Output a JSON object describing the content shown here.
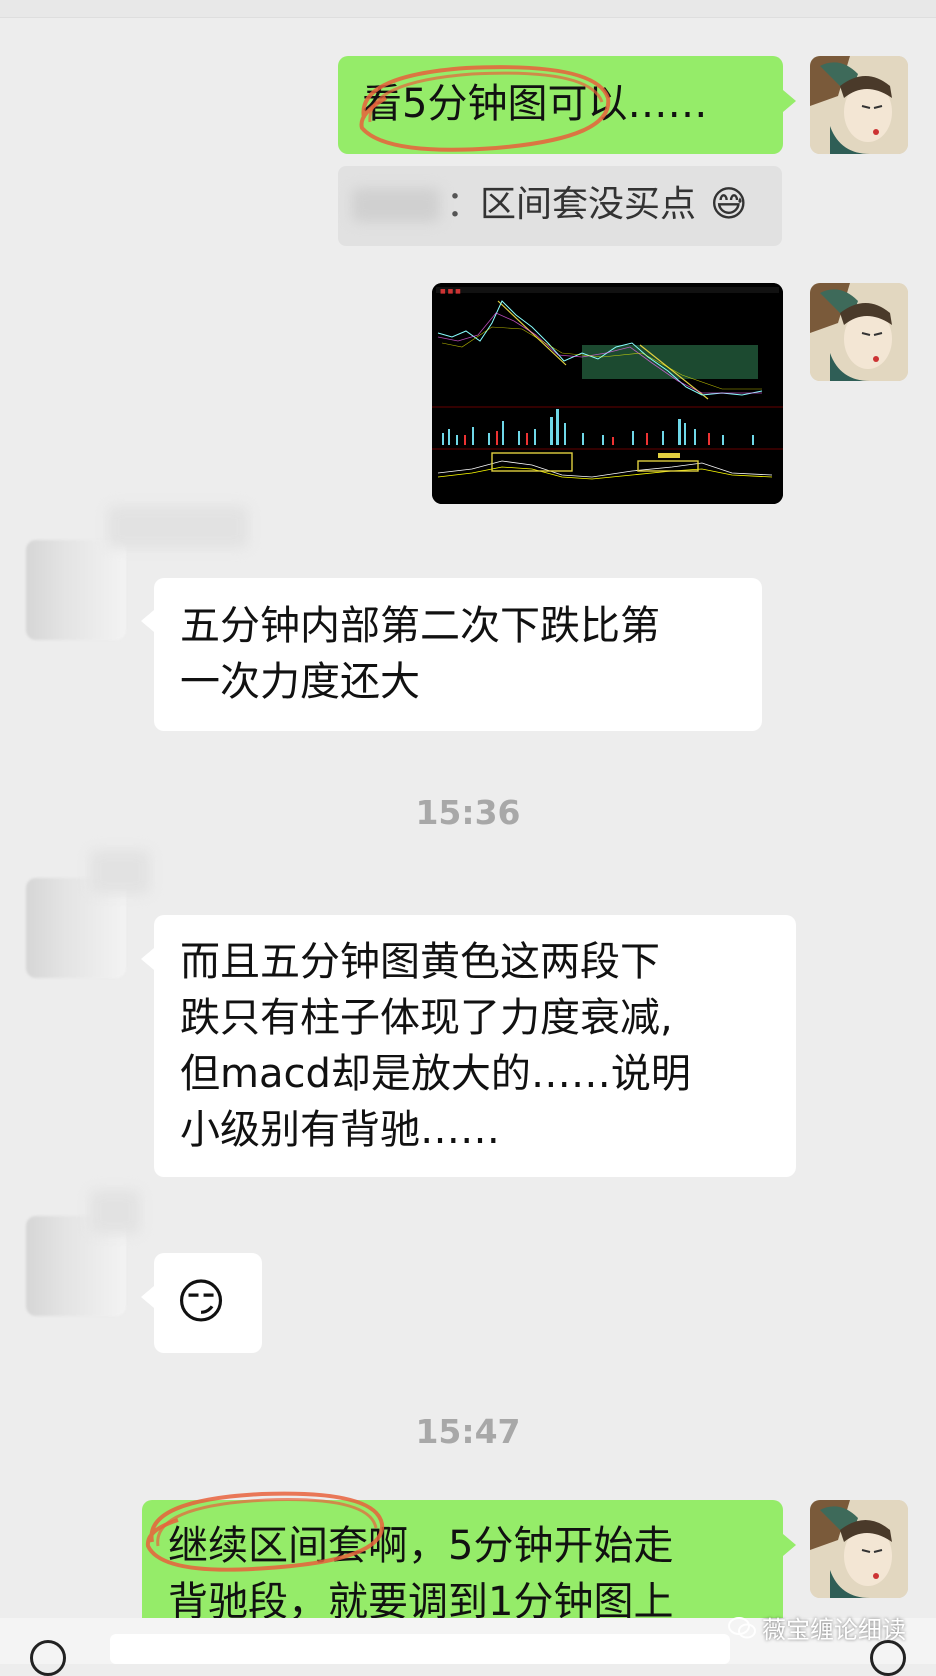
{
  "messages": [
    {
      "side": "right",
      "text": "看5分钟图可以……"
    },
    {
      "side": "right",
      "type": "quote",
      "text": "区间套没买点",
      "emoji": "😅"
    },
    {
      "side": "right",
      "type": "image",
      "image_name": "five-minute-kline-chart-screenshot"
    },
    {
      "side": "left",
      "text_lines": [
        "五分钟内部第二次下跌比第",
        "一次力度还大"
      ]
    },
    {
      "side": "left",
      "text_lines": [
        "而且五分钟图黄色这两段下",
        "跌只有柱子体现了力度衰减,",
        "但macd却是放大的……说明",
        "小级别有背驰……"
      ]
    },
    {
      "side": "left",
      "type": "emoji",
      "emoji": "😏"
    },
    {
      "side": "right",
      "text_lines": [
        "继续区间套啊，5分钟开始走",
        "背驰段，就要调到1分钟图上"
      ]
    }
  ],
  "timestamps": [
    "15:36",
    "15:47"
  ],
  "watermark": {
    "text": "薇宝缠论细读",
    "icon": "wechat-icon"
  },
  "colors": {
    "background": "#ededed",
    "me_bubble": "#95ec69",
    "other_bubble": "#ffffff",
    "timestamp": "#a8a8a8",
    "highlight_circle": "#e8623c"
  }
}
